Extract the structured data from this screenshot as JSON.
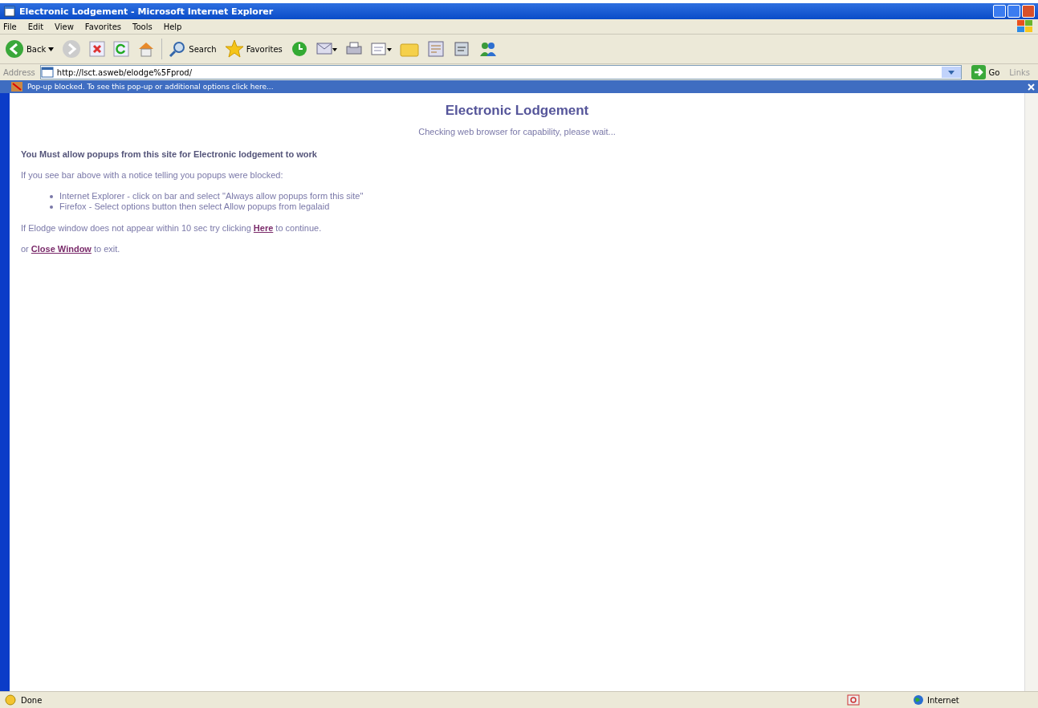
{
  "window": {
    "title": "Electronic Lodgement - Microsoft Internet Explorer"
  },
  "menu": [
    "File",
    "Edit",
    "View",
    "Favorites",
    "Tools",
    "Help"
  ],
  "toolbar": {
    "back": "Back",
    "search": "Search",
    "favorites": "Favorites"
  },
  "address_bar": {
    "label": "Address",
    "url": "http://lsct.asweb/elodge%5Fprod/",
    "go": "Go",
    "links": "Links"
  },
  "info_bar": {
    "text": "Pop-up blocked. To see this pop-up or additional options click here..."
  },
  "page": {
    "heading": "Electronic Lodgement",
    "status": "Checking web browser for capability, please wait...",
    "warning": "You Must allow popups from this site for Electronic lodgement to work",
    "intro": "If you see bar above with a notice telling you popups were blocked:",
    "bullets": [
      "Internet Explorer - click on bar and select \"Always allow popups form this site\"",
      "Firefox - Select options button then select Allow popups from legalaid"
    ],
    "retry": {
      "before": "If Elodge window does not appear within 10 sec try clicking ",
      "link": "Here",
      "after": " to continue."
    },
    "close": {
      "before": "or ",
      "link": "Close Window",
      "after": " to exit."
    }
  },
  "status_bar": {
    "status": "Done",
    "zone": "Internet"
  }
}
